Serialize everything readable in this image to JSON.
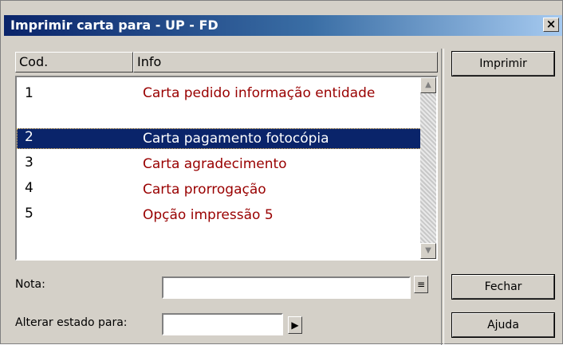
{
  "window": {
    "title": "Imprimir carta para - UP - FD",
    "close_label": "×"
  },
  "list": {
    "columns": [
      "Cod.",
      "Info"
    ],
    "rows": [
      {
        "code": "1",
        "info": "Carta pedido informação entidade",
        "selected": false
      },
      {
        "code": "2",
        "info": "Carta pagamento fotocópia",
        "selected": true
      },
      {
        "code": "3",
        "info": "Carta agradecimento",
        "selected": false
      },
      {
        "code": "4",
        "info": "Carta prorrogação",
        "selected": false
      },
      {
        "code": "5",
        "info": "Opção impressão 5",
        "selected": false
      }
    ]
  },
  "form": {
    "nota_label": "Nota:",
    "nota_value": "",
    "estado_label": "Alterar estado para:",
    "estado_value": ""
  },
  "buttons": {
    "imprimir": "Imprimir",
    "fechar": "Fechar",
    "ajuda": "Ajuda"
  },
  "icons": {
    "scroll_up": "▲",
    "scroll_down": "▼",
    "nota_picker": "≡",
    "estado_picker": "▶"
  }
}
